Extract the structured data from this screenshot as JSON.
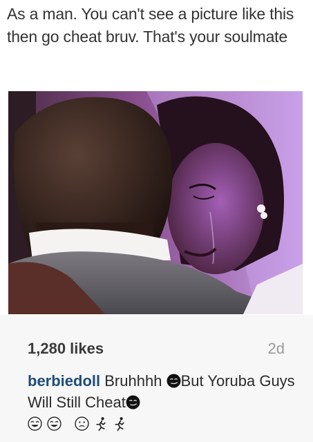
{
  "post": {
    "caption": "As a man. You can't see a picture like this then go cheat bruv. That's your soulmate",
    "likes": "1,280 likes",
    "time_ago": "2d"
  },
  "comment": {
    "username": "berbiedoll",
    "text_part1": "Bruhhhh",
    "text_part2": "But Yoruba Guys Will Still Cheat"
  },
  "emojis": {
    "inline1": "smirk-face-icon",
    "inline2": "smirk-face-icon",
    "row": [
      "laughing-face-icon",
      "laughing-face-icon",
      "sad-face-icon",
      "runner-icon",
      "runner-icon"
    ]
  },
  "colors": {
    "username": "#1f4d7a",
    "photo_accent": "#b56be0",
    "footer_bg": "#f7f7f7"
  }
}
